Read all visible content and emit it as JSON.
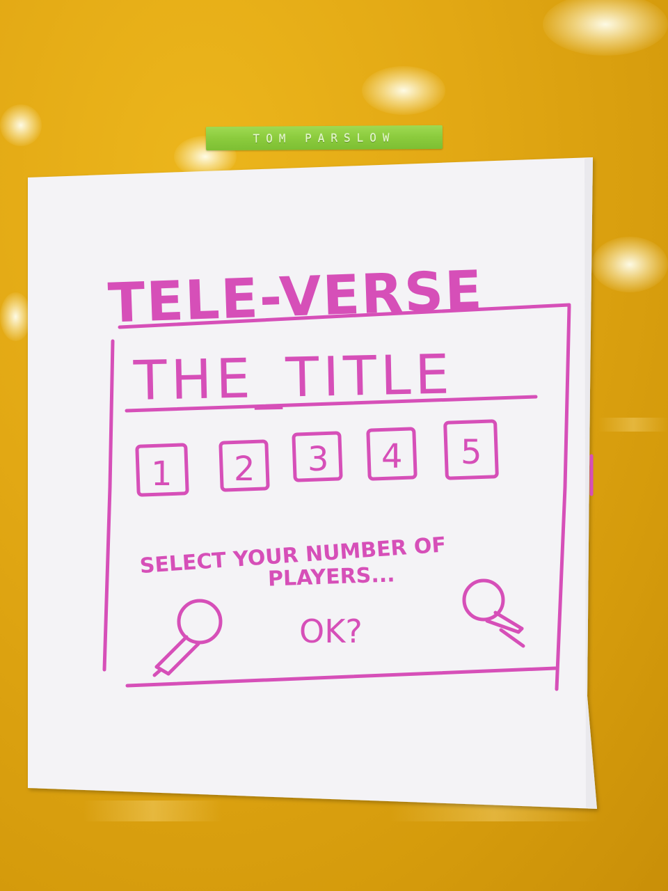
{
  "label_tape": {
    "text": "TOM PARSLOW"
  },
  "sketch": {
    "heading": "TELE-VERSE",
    "screen_title": "THE_TITLE",
    "player_options": [
      "1",
      "2",
      "3",
      "4",
      "5"
    ],
    "prompt_line1": "SELECT YOUR NUMBER OF",
    "prompt_line2": "PLAYERS...",
    "confirm": "OK?"
  },
  "icons": [
    "microphone-icon",
    "microphone-icon"
  ],
  "colors": {
    "wall": "#e2a814",
    "marker": "#d64fb8",
    "paper": "#f4f3f6",
    "tape": "#8bcb3d"
  }
}
